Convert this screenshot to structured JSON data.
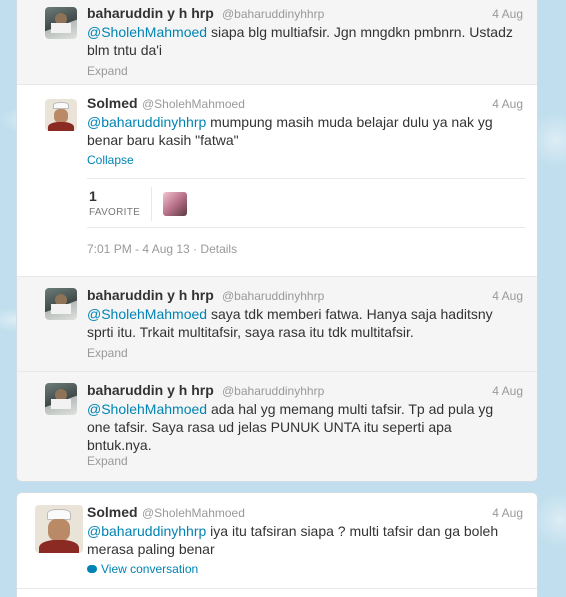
{
  "tweets": [
    {
      "fullname": "baharuddin y h hrp",
      "username": "@baharuddinyhhrp",
      "time": "4 Aug",
      "mention": "@SholehMahmoed",
      "text": " siapa blg multiafsir. Jgn mngdkn pmbnrn. Ustadz blm tntu da'i",
      "action": "Expand"
    },
    {
      "fullname": "Solmed",
      "username": "@SholehMahmoed",
      "time": "4 Aug",
      "mention": "@baharuddinyhhrp",
      "text": " mumpung masih muda belajar dulu ya nak yg benar baru kasih \"fatwa\"",
      "action": "Collapse",
      "favorites_count": "1",
      "favorites_label": "FAVORITE",
      "timestamp": "7:01 PM - 4 Aug 13",
      "details_label": "Details",
      "separator": " · "
    },
    {
      "fullname": "baharuddin y h hrp",
      "username": "@baharuddinyhhrp",
      "time": "4 Aug",
      "mention": "@SholehMahmoed",
      "text": " saya tdk memberi fatwa. Hanya saja haditsny sprti itu. Trkait multitafsir, saya rasa itu tdk multitafsir.",
      "action": "Expand"
    },
    {
      "fullname": "baharuddin y h hrp",
      "username": "@baharuddinyhhrp",
      "time": "4 Aug",
      "mention": "@SholehMahmoed",
      "text": " ada hal yg memang multi tafsir. Tp ad pula yg one tafsir. Saya rasa ud jelas PUNUK UNTA itu seperti apa bntuk.nya.",
      "action": "Expand"
    },
    {
      "fullname": "Solmed",
      "username": "@SholehMahmoed",
      "time": "4 Aug",
      "mention": "@baharuddinyhhrp",
      "text": " iya itu tafsiran siapa ? multi tafsir dan ga boleh merasa paling benar",
      "action": "View conversation"
    }
  ],
  "icons": {
    "conversation": "speech-bubble-icon",
    "avatar_baharuddin": "user-avatar",
    "avatar_solmed": "user-avatar"
  },
  "colors": {
    "link": "#0084b4",
    "background": "#c0deed",
    "muted": "#999999"
  }
}
